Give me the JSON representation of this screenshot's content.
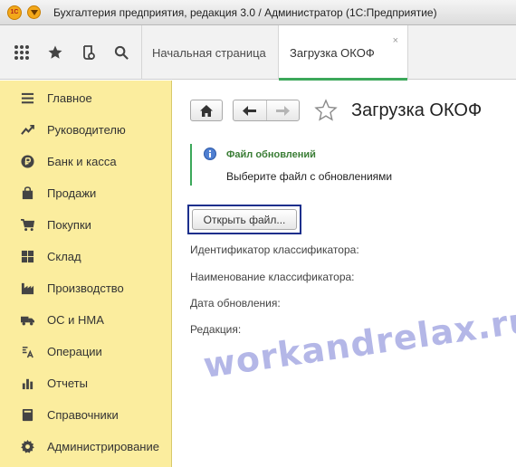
{
  "window": {
    "logo_text": "1С",
    "title": "Бухгалтерия предприятия, редакция 3.0 / Администратор  (1С:Предприятие)"
  },
  "toolbar": {
    "icons": [
      "apps-grid-icon",
      "favorites-star-icon",
      "history-icon",
      "search-icon"
    ]
  },
  "tabs": [
    {
      "label": "Начальная страница",
      "active": false
    },
    {
      "label": "Загрузка ОКОФ",
      "active": true,
      "close": "×"
    }
  ],
  "sidebar": {
    "items": [
      {
        "label": "Главное",
        "icon": "menu-lines-icon"
      },
      {
        "label": "Руководителю",
        "icon": "trend-chart-icon"
      },
      {
        "label": "Банк и касса",
        "icon": "ruble-coin-icon"
      },
      {
        "label": "Продажи",
        "icon": "shopping-bag-icon"
      },
      {
        "label": "Покупки",
        "icon": "shopping-cart-icon"
      },
      {
        "label": "Склад",
        "icon": "warehouse-boxes-icon"
      },
      {
        "label": "Производство",
        "icon": "factory-icon"
      },
      {
        "label": "ОС и НМА",
        "icon": "truck-icon"
      },
      {
        "label": "Операции",
        "icon": "operations-icon"
      },
      {
        "label": "Отчеты",
        "icon": "bar-chart-icon"
      },
      {
        "label": "Справочники",
        "icon": "book-icon"
      },
      {
        "label": "Администрирование",
        "icon": "gear-icon"
      }
    ]
  },
  "form": {
    "title": "Загрузка ОКОФ",
    "info_title": "Файл обновлений",
    "info_text": "Выберите файл с обновлениями",
    "open_button": "Открыть файл...",
    "fields": [
      "Идентификатор классификатора:",
      "Наименование классификатора:",
      "Дата обновления:",
      "Редакция:"
    ]
  },
  "watermark": "workandrelax.ru",
  "colors": {
    "sidebar_bg": "#fbed9e",
    "accent_green": "#3ca85a",
    "focus_frame": "#1c2f8c",
    "info_title": "#3a7d35"
  }
}
